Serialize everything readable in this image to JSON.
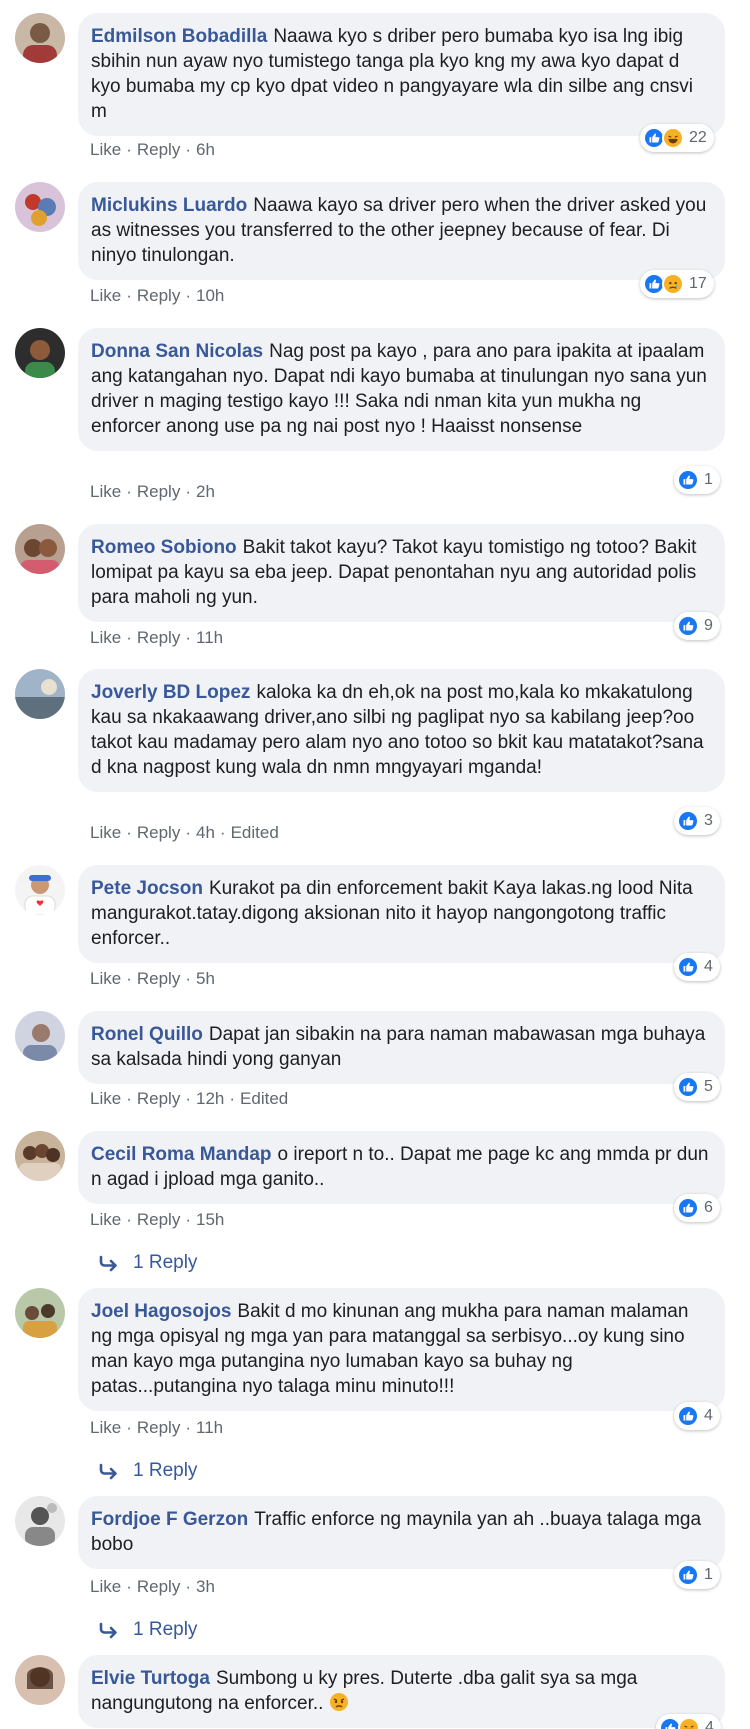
{
  "labels": {
    "like": "Like",
    "reply": "Reply",
    "separator": "·"
  },
  "colors": {
    "name": "#385898",
    "bubble": "#f0f2f5",
    "meta": "#606770",
    "like_blue": "#1877f2"
  },
  "comments": [
    {
      "author": "Edmilson Bobadilla",
      "text": "Naawa kyo s driber pero bumaba kyo isa lng ibig sbihin nun ayaw nyo tumistego tanga pla kyo kng my awa kyo dapat d kyo bumaba my cp kyo dpat video n pangyayare wla din silbe ang cnsvi m",
      "time": "6h",
      "edited": "",
      "reactions": [
        "like",
        "haha"
      ],
      "reaction_count": "22",
      "replies": ""
    },
    {
      "author": "Miclukins Luardo",
      "text": "Naawa kayo sa driver pero when the driver asked you as witnesses you transferred to the other jeepney because of fear. Di ninyo tinulongan.",
      "time": "10h",
      "edited": "",
      "reactions": [
        "like",
        "sad"
      ],
      "reaction_count": "17",
      "replies": ""
    },
    {
      "author": "Donna San Nicolas",
      "text": "Nag post pa kayo , para ano para ipakita at ipaalam ang katangahan nyo. Dapat ndi kayo bumaba at tinulungan nyo sana yun driver n maging testigo kayo !!! Saka ndi nman kita yun mukha ng enforcer anong use pa ng nai post nyo ! Haaisst nonsense",
      "time": "2h",
      "edited": "",
      "reactions": [
        "like"
      ],
      "reaction_count": "1",
      "replies": ""
    },
    {
      "author": "Romeo Sobiono",
      "text": "Bakit takot kayu? Takot kayu tomistigo ng totoo? Bakit lomipat pa kayu sa eba jeep. Dapat penontahan nyu ang autoridad polis para maholi ng yun.",
      "time": "11h",
      "edited": "",
      "reactions": [
        "like"
      ],
      "reaction_count": "9",
      "replies": ""
    },
    {
      "author": "Joverly BD Lopez",
      "text": "kaloka ka dn eh,ok na post mo,kala ko mkakatulong kau sa nkakaawang driver,ano silbi ng paglipat nyo sa kabilang jeep?oo takot kau madamay pero alam nyo ano totoo so bkit kau matatakot?sana d kna nagpost kung wala dn nmn mngyayari mganda!",
      "time": "4h",
      "edited": "Edited",
      "reactions": [
        "like"
      ],
      "reaction_count": "3",
      "replies": ""
    },
    {
      "author": "Pete Jocson",
      "text": "Kurakot pa din enforcement bakit Kaya lakas.ng lood Nita mangurakot.tatay.digong aksionan nito it hayop nangongotong traffic enforcer..",
      "time": "5h",
      "edited": "",
      "reactions": [
        "like"
      ],
      "reaction_count": "4",
      "replies": ""
    },
    {
      "author": "Ronel Quillo",
      "text": "Dapat jan sibakin na para naman mabawasan mga buhaya sa kalsada hindi yong ganyan",
      "time": "12h",
      "edited": "Edited",
      "reactions": [
        "like"
      ],
      "reaction_count": "5",
      "replies": ""
    },
    {
      "author": "Cecil Roma Mandap",
      "text": "o ireport n to.. Dapat me page kc ang mmda pr dun n agad i jpload mga ganito..",
      "time": "15h",
      "edited": "",
      "reactions": [
        "like"
      ],
      "reaction_count": "6",
      "replies": "1 Reply"
    },
    {
      "author": "Joel Hagosojos",
      "text": "Bakit d mo kinunan ang mukha para naman malaman ng mga opisyal ng mga yan para matanggal sa serbisyo...oy kung sino man kayo mga putangina nyo lumaban kayo sa buhay ng patas...putangina nyo talaga minu minuto!!!",
      "time": "11h",
      "edited": "",
      "reactions": [
        "like"
      ],
      "reaction_count": "4",
      "replies": "1 Reply"
    },
    {
      "author": "Fordjoe F Gerzon",
      "text": "Traffic enforce ng maynila yan ah ..buaya talaga mga bobo",
      "time": "3h",
      "edited": "",
      "reactions": [
        "like"
      ],
      "reaction_count": "1",
      "replies": "1 Reply"
    },
    {
      "author": "Elvie Turtoga",
      "text": "Sumbong u ky pres. Duterte .dba galit sya sa mga nangungutong na enforcer..",
      "time": "",
      "edited": "",
      "reactions": [
        "like",
        "haha"
      ],
      "reaction_count": "4",
      "replies": ""
    }
  ]
}
